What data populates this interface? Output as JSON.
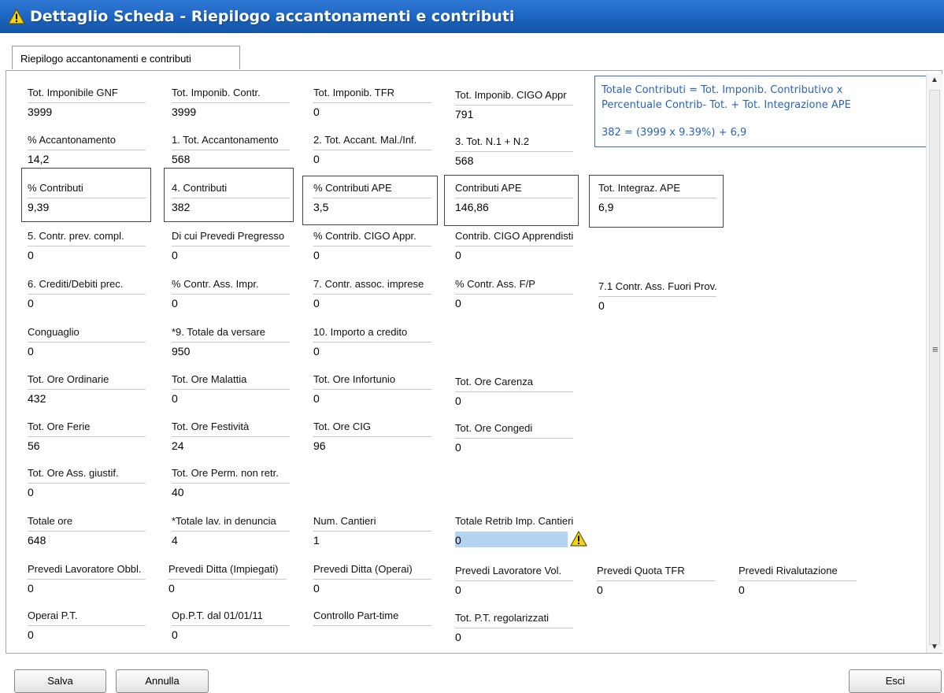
{
  "window": {
    "title": "Dettaglio Scheda - Riepilogo accantonamenti e contributi"
  },
  "tab": {
    "label": "Riepilogo accantonamenti e contributi"
  },
  "tooltip": {
    "line1": "Totale Contributi = Tot. Imponib. Contributivo x",
    "line2": "Percentuale Contrib- Tot. + Tot. Integrazione APE",
    "line3": "382 = (3999 x 9.39%) + 6,9"
  },
  "fields": {
    "tot_imponibile_gnf": {
      "label": "Tot. Imponibile GNF",
      "value": "3999"
    },
    "tot_imponib_contr": {
      "label": "Tot. Imponib. Contr.",
      "value": "3999"
    },
    "tot_imponib_tfr": {
      "label": "Tot. Imponib. TFR",
      "value": "0"
    },
    "tot_imponib_cigo_appr": {
      "label": "Tot. Imponib. CIGO Appr",
      "value": "791"
    },
    "perc_accantonamento": {
      "label": "% Accantonamento",
      "value": "14,2"
    },
    "tot_accantonamento": {
      "label": "1. Tot. Accantonamento",
      "value": "568"
    },
    "tot_accant_mal_inf": {
      "label": "2. Tot. Accant. Mal./Inf.",
      "value": "0"
    },
    "tot_n1_n2": {
      "label": "3. Tot. N.1 + N.2",
      "value": "568"
    },
    "perc_contributi": {
      "label": "% Contributi",
      "value": "9,39"
    },
    "contributi": {
      "label": "4. Contributi",
      "value": "382"
    },
    "perc_contributi_ape": {
      "label": "% Contributi APE",
      "value": "3,5"
    },
    "contributi_ape": {
      "label": "Contributi APE",
      "value": "146,86"
    },
    "tot_integraz_ape": {
      "label": "Tot. Integraz. APE",
      "value": "6,9"
    },
    "contr_prev_compl": {
      "label": "5. Contr. prev. compl.",
      "value": "0"
    },
    "di_cui_prevedi_pregresso": {
      "label": "Di cui Prevedi Pregresso",
      "value": "0"
    },
    "perc_contrib_cigo_appr": {
      "label": "% Contrib. CIGO Appr.",
      "value": "0"
    },
    "contrib_cigo_apprendisti": {
      "label": "Contrib. CIGO Apprendisti",
      "value": "0"
    },
    "crediti_debiti_prec": {
      "label": "6. Crediti/Debiti prec.",
      "value": "0"
    },
    "perc_contr_ass_impr": {
      "label": "% Contr. Ass. Impr.",
      "value": "0"
    },
    "contr_assoc_imprese": {
      "label": "7. Contr. assoc. imprese",
      "value": "0"
    },
    "perc_contr_ass_fp": {
      "label": "% Contr. Ass. F/P",
      "value": "0"
    },
    "contr_ass_fuori_prov": {
      "label": "7.1 Contr. Ass. Fuori Prov.",
      "value": "0"
    },
    "conguaglio": {
      "label": "Conguaglio",
      "value": "0"
    },
    "totale_da_versare": {
      "label": "*9. Totale da versare",
      "value": "950"
    },
    "importo_a_credito": {
      "label": "10. Importo a credito",
      "value": "0"
    },
    "tot_ore_ordinarie": {
      "label": "Tot. Ore Ordinarie",
      "value": "432"
    },
    "tot_ore_malattia": {
      "label": "Tot. Ore Malattia",
      "value": "0"
    },
    "tot_ore_infortunio": {
      "label": "Tot. Ore Infortunio",
      "value": "0"
    },
    "tot_ore_carenza": {
      "label": "Tot. Ore Carenza",
      "value": "0"
    },
    "tot_ore_ferie": {
      "label": "Tot. Ore Ferie",
      "value": "56"
    },
    "tot_ore_festivita": {
      "label": "Tot. Ore Festività",
      "value": "24"
    },
    "tot_ore_cig": {
      "label": "Tot. Ore CIG",
      "value": "96"
    },
    "tot_ore_congedi": {
      "label": "Tot. Ore Congedi",
      "value": "0"
    },
    "tot_ore_ass_giustif": {
      "label": "Tot. Ore Ass. giustif.",
      "value": "0"
    },
    "tot_ore_perm_non_retr": {
      "label": "Tot. Ore Perm. non retr.",
      "value": "40"
    },
    "totale_ore": {
      "label": "Totale ore",
      "value": "648"
    },
    "totale_lav_in_denuncia": {
      "label": "*Totale lav. in denuncia",
      "value": "4"
    },
    "num_cantieri": {
      "label": "Num. Cantieri",
      "value": "1"
    },
    "totale_retrib_imp_cantieri": {
      "label": "Totale Retrib Imp. Cantieri",
      "value": "0"
    },
    "prevedi_lavoratore_obbl": {
      "label": "Prevedi Lavoratore Obbl.",
      "value": "0"
    },
    "prevedi_ditta_impiegati": {
      "label": "Prevedi Ditta (Impiegati)",
      "value": "0"
    },
    "prevedi_ditta_operai": {
      "label": "Prevedi Ditta (Operai)",
      "value": "0"
    },
    "prevedi_lavoratore_vol": {
      "label": "Prevedi Lavoratore Vol.",
      "value": "0"
    },
    "prevedi_quota_tfr": {
      "label": "Prevedi Quota TFR",
      "value": "0"
    },
    "prevedi_rivalutazione": {
      "label": "Prevedi Rivalutazione",
      "value": "0"
    },
    "operai_pt": {
      "label": "Operai P.T.",
      "value": "0"
    },
    "op_pt_dal": {
      "label": "Op.P.T. dal 01/01/11",
      "value": "0"
    },
    "controllo_part_time": {
      "label": "Controllo Part-time",
      "value": ""
    },
    "tot_pt_regolarizzati": {
      "label": "Tot. P.T. regolarizzati",
      "value": "0"
    }
  },
  "buttons": {
    "salva": "Salva",
    "annulla": "Annulla",
    "esci": "Esci"
  },
  "colors": {
    "titlebar": "#1b63be",
    "tooltip_text": "#2a64b8",
    "highlight": "#b3d4f0",
    "warning": "#f2d21b"
  }
}
